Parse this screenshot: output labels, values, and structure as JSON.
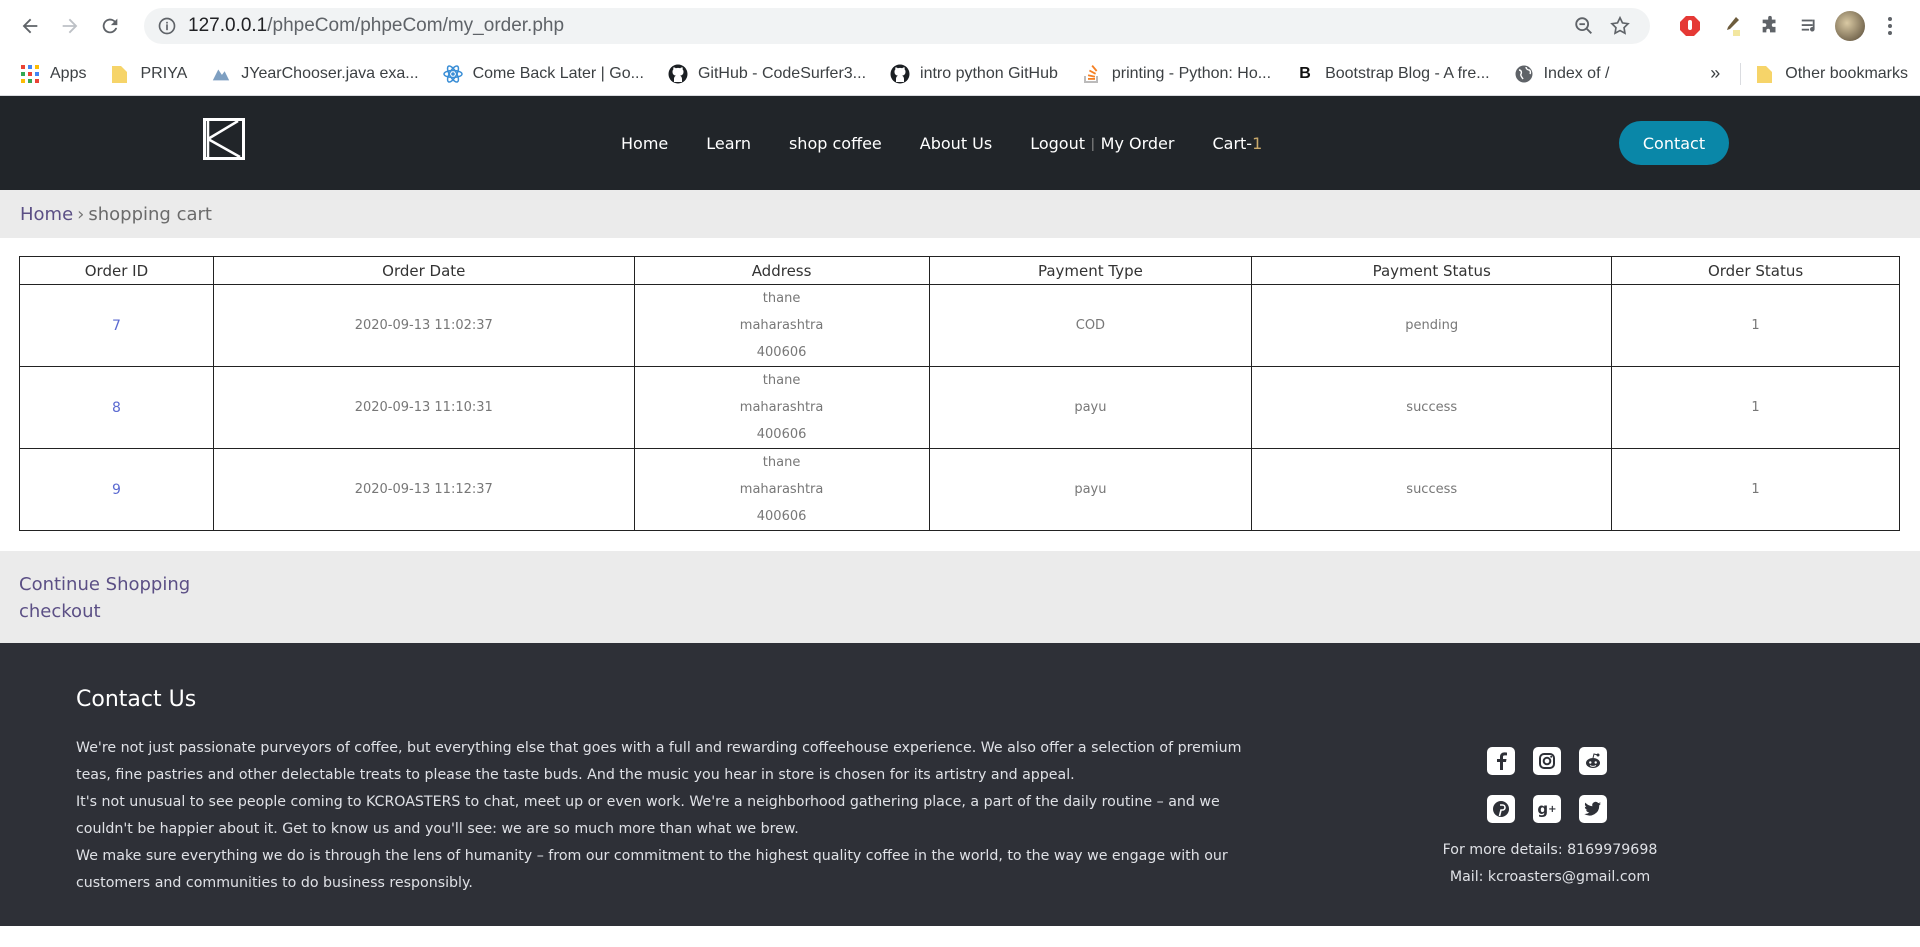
{
  "browser": {
    "url_host": "127.0.0.1",
    "url_path": "/phpeCom/phpeCom/my_order.php",
    "bookmarks": [
      {
        "label": "Apps",
        "icon": "apps-grid-icon"
      },
      {
        "label": "PRIYA",
        "icon": "folder-icon"
      },
      {
        "label": "JYearChooser.java exa...",
        "icon": "site-icon"
      },
      {
        "label": "Come Back Later | Go...",
        "icon": "react-icon"
      },
      {
        "label": "GitHub - CodeSurfer3...",
        "icon": "github-icon"
      },
      {
        "label": "intro python GitHub",
        "icon": "github-icon"
      },
      {
        "label": "printing - Python: Ho...",
        "icon": "stackoverflow-icon"
      },
      {
        "label": "Bootstrap Blog - A fre...",
        "icon": "bootstrap-icon"
      },
      {
        "label": "Index of /",
        "icon": "globe-icon"
      }
    ],
    "more_label": "»",
    "other_bookmarks": "Other bookmarks"
  },
  "header": {
    "nav": {
      "home": "Home",
      "learn": "Learn",
      "shop": "shop coffee",
      "about": "About Us",
      "logout": "Logout",
      "separator": "|",
      "my_order": "My Order",
      "cart": "Cart-",
      "cart_count": "1"
    },
    "contact_label": "Contact"
  },
  "breadcrumb": {
    "home": "Home",
    "separator": "›",
    "current": "shopping cart"
  },
  "orders": {
    "columns": [
      "Order ID",
      "Order Date",
      "Address",
      "Payment Type",
      "Payment Status",
      "Order Status"
    ],
    "rows": [
      {
        "id": "7",
        "date": "2020-09-13 11:02:37",
        "address": [
          "thane",
          "maharashtra",
          "400606"
        ],
        "payment_type": "COD",
        "payment_status": "pending",
        "order_status": "1"
      },
      {
        "id": "8",
        "date": "2020-09-13 11:10:31",
        "address": [
          "thane",
          "maharashtra",
          "400606"
        ],
        "payment_type": "payu",
        "payment_status": "success",
        "order_status": "1"
      },
      {
        "id": "9",
        "date": "2020-09-13 11:12:37",
        "address": [
          "thane",
          "maharashtra",
          "400606"
        ],
        "payment_type": "payu",
        "payment_status": "success",
        "order_status": "1"
      }
    ]
  },
  "actions": {
    "continue_shopping": "Continue Shopping",
    "checkout": "checkout"
  },
  "footer": {
    "title": "Contact Us",
    "paragraphs": [
      "We're not just passionate purveyors of coffee, but everything else that goes with a full and rewarding coffeehouse experience. We also offer a selection of premium teas, fine pastries and other delectable treats to please the taste buds. And the music you hear in store is chosen for its artistry and appeal.",
      "It's not unusual to see people coming to KCROASTERS to chat, meet up or even work. We're a neighborhood gathering place, a part of the daily routine – and we couldn't be happier about it. Get to know us and you'll see: we are so much more than what we brew.",
      "We make sure everything we do is through the lens of humanity – from our commitment to the highest quality coffee in the world, to the way we engage with our customers and communities to do business responsibly."
    ],
    "details": "For more details: 8169979698",
    "mail": "Mail: kcroasters@gmail.com"
  },
  "colors": {
    "header_bg": "#212529",
    "contact_btn": "#0a87a8",
    "footer_bg": "#2e3037",
    "breadcrumb_bg": "#ebebeb",
    "link": "#5b4f85"
  }
}
